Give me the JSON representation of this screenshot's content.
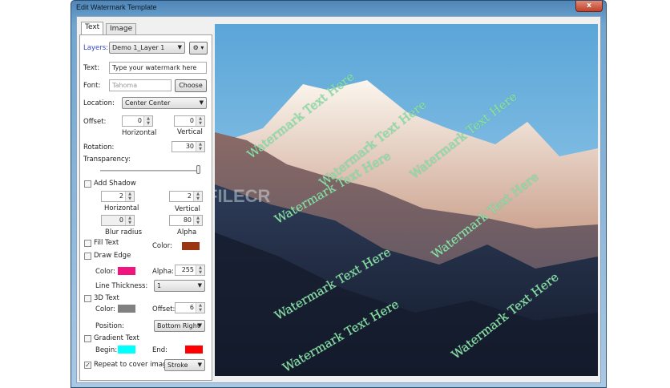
{
  "window": {
    "title": "Edit Watermark Template",
    "close": "x"
  },
  "tabs": [
    "Text",
    "Image"
  ],
  "layers": {
    "label": "Layers:",
    "value": "Demo 1_Layer 1",
    "gear": "⚙ ▾"
  },
  "text": {
    "label": "Text:",
    "value": "Type your watermark here"
  },
  "font": {
    "label": "Font:",
    "value": "Tahoma",
    "button": "Choose"
  },
  "location": {
    "label": "Location:",
    "value": "Center Center"
  },
  "offset": {
    "label": "Offset:",
    "horizontal": "0",
    "vertical": "0",
    "h_label": "Horizontal",
    "v_label": "Vertical"
  },
  "rotation": {
    "label": "Rotation:",
    "value": "30"
  },
  "transparency": {
    "label": "Transparency:",
    "value": 1.0
  },
  "shadow": {
    "label": "Add Shadow",
    "checked": false,
    "horizontal": "2",
    "vertical": "2",
    "h_label": "Horizontal",
    "v_label": "Vertical",
    "blur": "0",
    "blur_label": "Blur radius",
    "alpha": "80",
    "alpha_label": "Alpha"
  },
  "fill": {
    "label": "Fill Text",
    "color_label": "Color:",
    "color": "#9b3512"
  },
  "edge": {
    "label": "Draw Edge",
    "color_label": "Color:",
    "color": "#f0147e",
    "alpha_label": "Alpha:",
    "alpha": "255",
    "thickness_label": "Line Thickness:",
    "thickness": "1"
  },
  "text3d": {
    "label": "3D Text",
    "color_label": "Color:",
    "color": "#808080",
    "offset_label": "Offset:",
    "offset": "6",
    "position_label": "Position:",
    "position": "Bottom Right"
  },
  "gradient": {
    "label": "Gradient Text",
    "begin_label": "Begin:",
    "begin": "#00ffff",
    "end_label": "End:",
    "end": "#ff0000"
  },
  "repeat": {
    "label": "Repeat to cover image",
    "checked": true,
    "mode": "Stroke"
  },
  "preview": {
    "watermark": "Watermark Text Here",
    "overlay": "FILECR"
  }
}
